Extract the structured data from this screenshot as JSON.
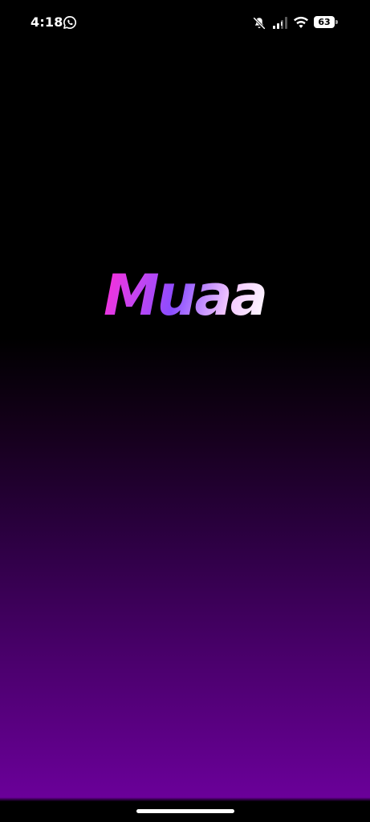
{
  "status_bar": {
    "time": "4:18",
    "battery_level": "63",
    "icons": [
      "whatsapp-icon",
      "mute-icon",
      "signal-icon",
      "wifi-icon",
      "battery-icon"
    ]
  },
  "splash": {
    "app_name": "Muaa",
    "gradient_colors": [
      "#ff2bd6",
      "#c744f0",
      "#8a4dff",
      "#f3c7ff",
      "#ffffff"
    ],
    "background_bottom_color": "#6a0099"
  }
}
